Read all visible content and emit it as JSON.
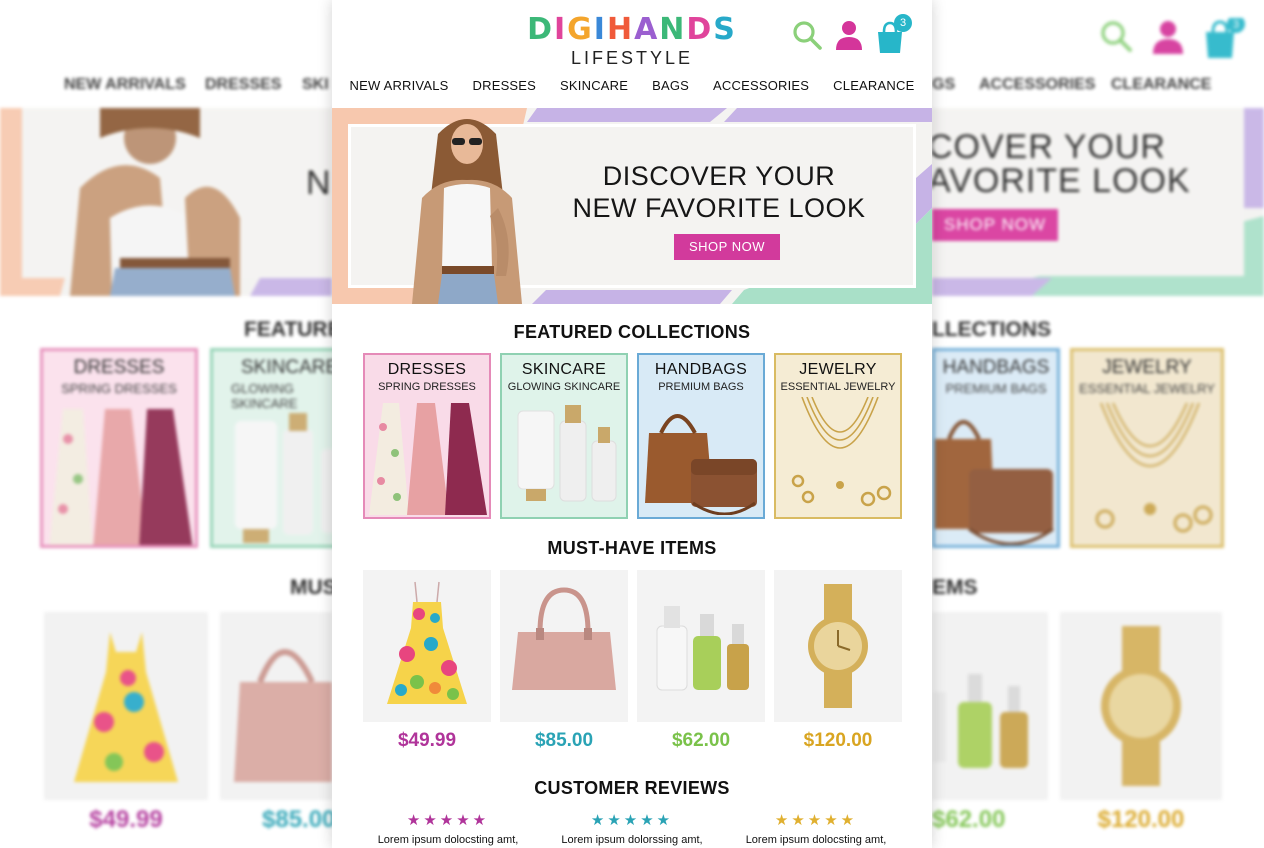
{
  "brand": {
    "logo_letters": [
      "D",
      "I",
      "G",
      "I",
      "H",
      "A",
      "N",
      "D",
      "S"
    ],
    "logo_colors": [
      "#3cb878",
      "#e0449b",
      "#f4a52c",
      "#3a88d8",
      "#f05a3a",
      "#9b5fd0",
      "#3cb878",
      "#e0449b",
      "#27a9c9"
    ],
    "tagline": "LIFESTYLE"
  },
  "header_icons": {
    "search": "search-icon",
    "account": "user-icon",
    "cart": "shopping-bag-icon",
    "cart_count": "3"
  },
  "nav": {
    "items": [
      "NEW ARRIVALS",
      "DRESSES",
      "SKINCARE",
      "BAGS",
      "ACCESSORIES",
      "CLEARANCE"
    ]
  },
  "hero": {
    "title_line1": "DISCOVER YOUR",
    "title_line2": "NEW FAVORITE LOOK",
    "button": "SHOP NOW",
    "button_color": "#d23a9c"
  },
  "featured": {
    "title": "FEATURED COLLECTIONS",
    "cards": [
      {
        "title": "DRESSES",
        "subtitle": "SPRING DRESSES",
        "border": "#e58ab8",
        "bg": "#f9dbe8"
      },
      {
        "title": "SKINCARE",
        "subtitle": "GLOWING SKINCARE",
        "border": "#8fd1b2",
        "bg": "#dff3ea"
      },
      {
        "title": "HANDBAGS",
        "subtitle": "PREMIUM BAGS",
        "border": "#6aaad6",
        "bg": "#d8eaf6"
      },
      {
        "title": "JEWELRY",
        "subtitle": "ESSENTIAL JEWELRY",
        "border": "#d9bb62",
        "bg": "#f5ecd4"
      }
    ]
  },
  "must_have": {
    "title": "MUST-HAVE ITEMS",
    "items": [
      {
        "name": "floral-dress",
        "price": "$49.99",
        "color": "#b0349a"
      },
      {
        "name": "pink-handbag",
        "price": "$85.00",
        "color": "#2aa3b5"
      },
      {
        "name": "serum-set",
        "price": "$62.00",
        "color": "#7ac24a"
      },
      {
        "name": "gold-watch",
        "price": "$120.00",
        "color": "#d9a521"
      }
    ]
  },
  "reviews": {
    "title": "CUSTOMER REVIEWS",
    "items": [
      {
        "stars": "★★★★★",
        "text": "Lorem ipsum dolocsting amt,",
        "color": "#b0349a"
      },
      {
        "stars": "★★★★★",
        "text": "Lorem ipsum dolorssing amt,",
        "color": "#2aa3b5"
      },
      {
        "stars": "★★★★★",
        "text": "Lorem ipsum dolocsting amt,",
        "color": "#e0b030"
      }
    ]
  }
}
